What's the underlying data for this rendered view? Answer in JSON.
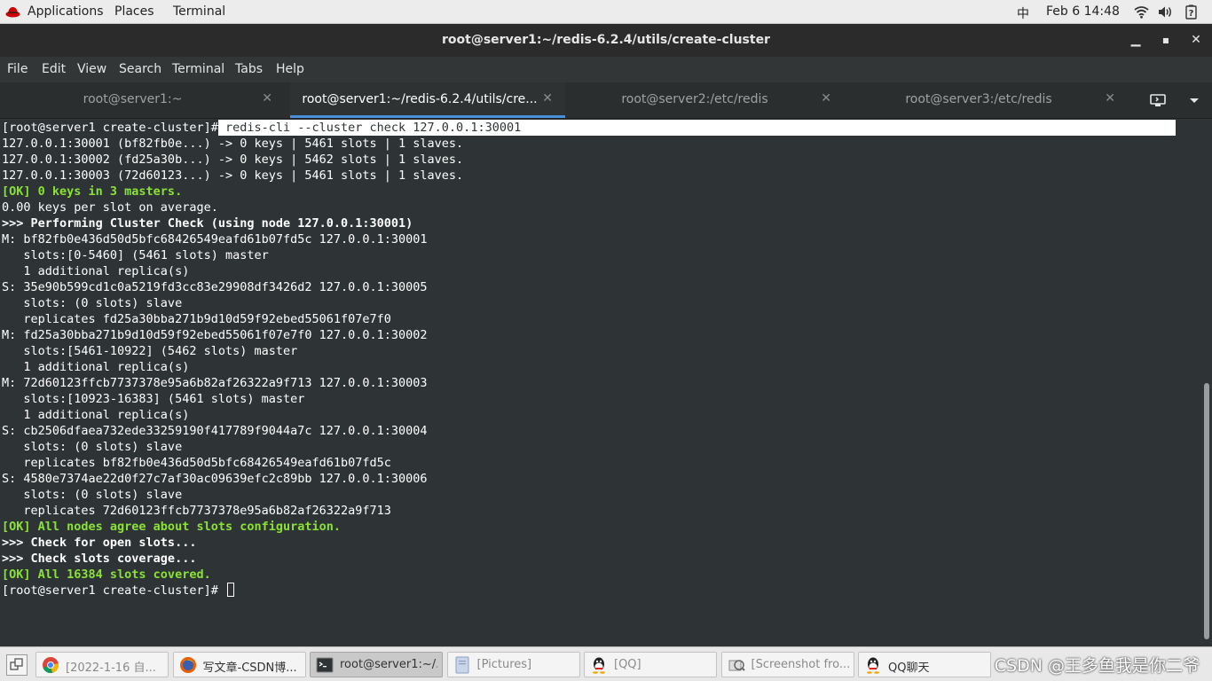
{
  "top_panel": {
    "applications": "Applications",
    "places": "Places",
    "terminal": "Terminal",
    "input_method": "中",
    "datetime": "Feb 6  14:48",
    "icons": [
      "redhat-icon",
      "wifi-icon",
      "volume-icon",
      "power-icon"
    ]
  },
  "window": {
    "title": "root@server1:~/redis-6.2.4/utils/create-cluster",
    "minimize": "▁",
    "maximize": "▪",
    "close": "✕"
  },
  "menubar": {
    "items": [
      "File",
      "Edit",
      "View",
      "Search",
      "Terminal",
      "Tabs",
      "Help"
    ]
  },
  "tabs": [
    {
      "label": "root@server1:~",
      "active": false
    },
    {
      "label": "root@server1:~/redis-6.2.4/utils/cre...",
      "active": true
    },
    {
      "label": "root@server2:/etc/redis",
      "active": false
    },
    {
      "label": "root@server3:/etc/redis",
      "active": false
    }
  ],
  "tab_close": "✕",
  "terminal": {
    "prompt": "[root@server1 create-cluster]#",
    "command": " redis-cli --cluster check 127.0.0.1:30001",
    "lines": [
      {
        "text": "127.0.0.1:30001 (bf82fb0e...) -> 0 keys | 5461 slots | 1 slaves.",
        "style": ""
      },
      {
        "text": "127.0.0.1:30002 (fd25a30b...) -> 0 keys | 5462 slots | 1 slaves.",
        "style": ""
      },
      {
        "text": "127.0.0.1:30003 (72d60123...) -> 0 keys | 5461 slots | 1 slaves.",
        "style": ""
      },
      {
        "text": "[OK] 0 keys in 3 masters.",
        "style": "green"
      },
      {
        "text": "0.00 keys per slot on average.",
        "style": ""
      },
      {
        "text": ">>> Performing Cluster Check (using node 127.0.0.1:30001)",
        "style": "bold"
      },
      {
        "text": "M: bf82fb0e436d50d5bfc68426549eafd61b07fd5c 127.0.0.1:30001",
        "style": ""
      },
      {
        "text": "   slots:[0-5460] (5461 slots) master",
        "style": ""
      },
      {
        "text": "   1 additional replica(s)",
        "style": ""
      },
      {
        "text": "S: 35e90b599cd1c0a5219fd3cc83e29908df3426d2 127.0.0.1:30005",
        "style": ""
      },
      {
        "text": "   slots: (0 slots) slave",
        "style": ""
      },
      {
        "text": "   replicates fd25a30bba271b9d10d59f92ebed55061f07e7f0",
        "style": ""
      },
      {
        "text": "M: fd25a30bba271b9d10d59f92ebed55061f07e7f0 127.0.0.1:30002",
        "style": ""
      },
      {
        "text": "   slots:[5461-10922] (5462 slots) master",
        "style": ""
      },
      {
        "text": "   1 additional replica(s)",
        "style": ""
      },
      {
        "text": "M: 72d60123ffcb7737378e95a6b82af26322a9f713 127.0.0.1:30003",
        "style": ""
      },
      {
        "text": "   slots:[10923-16383] (5461 slots) master",
        "style": ""
      },
      {
        "text": "   1 additional replica(s)",
        "style": ""
      },
      {
        "text": "S: cb2506dfaea732ede33259190f417789f9044a7c 127.0.0.1:30004",
        "style": ""
      },
      {
        "text": "   slots: (0 slots) slave",
        "style": ""
      },
      {
        "text": "   replicates bf82fb0e436d50d5bfc68426549eafd61b07fd5c",
        "style": ""
      },
      {
        "text": "S: 4580e7374ae22d0f27c7af30ac09639efc2c89bb 127.0.0.1:30006",
        "style": ""
      },
      {
        "text": "   slots: (0 slots) slave",
        "style": ""
      },
      {
        "text": "   replicates 72d60123ffcb7737378e95a6b82af26322a9f713",
        "style": ""
      },
      {
        "text": "[OK] All nodes agree about slots configuration.",
        "style": "green"
      },
      {
        "text": ">>> Check for open slots...",
        "style": "bold"
      },
      {
        "text": ">>> Check slots coverage...",
        "style": "bold"
      },
      {
        "text": "[OK] All 16384 slots covered.",
        "style": "green"
      }
    ],
    "final_prompt": "[root@server1 create-cluster]# "
  },
  "scrollbar": {
    "position_fraction": 0.5,
    "visible_fraction": 0.5
  },
  "taskbar": {
    "tasks": [
      {
        "label": "[2022-1-16 自...",
        "icon": "chrome-icon",
        "dim": true,
        "active": false
      },
      {
        "label": "写文章-CSDN博...",
        "icon": "firefox-icon",
        "dim": false,
        "active": false
      },
      {
        "label": "root@server1:~/...",
        "icon": "terminal-icon",
        "dim": false,
        "active": true
      },
      {
        "label": "[Pictures]",
        "icon": "folder-icon",
        "dim": true,
        "active": false
      },
      {
        "label": "[QQ]",
        "icon": "qq-icon",
        "dim": true,
        "active": false
      },
      {
        "label": "[Screenshot fro...",
        "icon": "screenshot-icon",
        "dim": true,
        "active": false
      },
      {
        "label": "QQ聊天",
        "icon": "qq-icon",
        "dim": false,
        "active": false
      }
    ],
    "watermark": "CSDN @王多鱼我是你二爷"
  }
}
